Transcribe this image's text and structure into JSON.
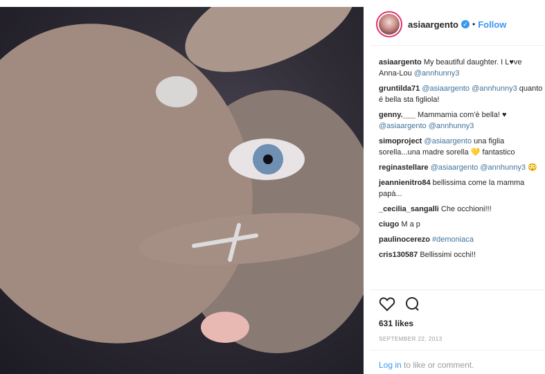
{
  "post": {
    "username": "asiaargento",
    "follow_label": "Follow",
    "dot": "•",
    "verified_mark": "✓",
    "caption_text": "My beautiful daughter. I L",
    "caption_emoji": "♥",
    "caption_rest": "ve",
    "caption_line2": "Anna-Lou ",
    "caption_mention": "@annhunny3"
  },
  "comments": [
    {
      "user": "gruntilda71",
      "parts": [
        {
          "t": " "
        },
        {
          "m": "@asiaargento"
        },
        {
          "t": " "
        },
        {
          "m": "@annhunny3"
        },
        {
          "t": " quanto é bella sta figliola!"
        }
      ]
    },
    {
      "user": "genny.___",
      "parts": [
        {
          "t": " Mammamia com'è bella! ♥ "
        },
        {
          "m": "@asiaargento"
        },
        {
          "t": " "
        },
        {
          "m": "@annhunny3"
        }
      ]
    },
    {
      "user": "simoproject",
      "parts": [
        {
          "t": " "
        },
        {
          "m": "@asiaargento"
        },
        {
          "t": " una figlia sorella...una madre sorella 💛 fantastico"
        }
      ]
    },
    {
      "user": "reginastellare",
      "parts": [
        {
          "t": " "
        },
        {
          "m": "@asiaargento"
        },
        {
          "t": " "
        },
        {
          "m": "@annhunny3"
        },
        {
          "t": " 😳"
        }
      ]
    },
    {
      "user": "jeannienitro84",
      "parts": [
        {
          "t": " bellissima come la mamma papà..."
        }
      ]
    },
    {
      "user": "_cecilia_sangalli",
      "parts": [
        {
          "t": " Che occhioni!!!"
        }
      ]
    },
    {
      "user": "ciugo",
      "parts": [
        {
          "t": " M a p"
        }
      ]
    },
    {
      "user": "paulinocerezo",
      "parts": [
        {
          "t": " "
        },
        {
          "m": "#demoniaca"
        }
      ]
    },
    {
      "user": "cris130587",
      "parts": [
        {
          "t": " Bellissimi occhi!!"
        }
      ]
    }
  ],
  "likes": "631 likes",
  "date": "SEPTEMBER 22, 2013",
  "login": {
    "link": "Log in",
    "rest": " to like or comment."
  },
  "icons": {
    "like": "heart-icon",
    "comment": "comment-icon"
  },
  "colors": {
    "link": "#3897f0",
    "mention": "#3f729b",
    "avatar_ring": "#e1306c"
  }
}
